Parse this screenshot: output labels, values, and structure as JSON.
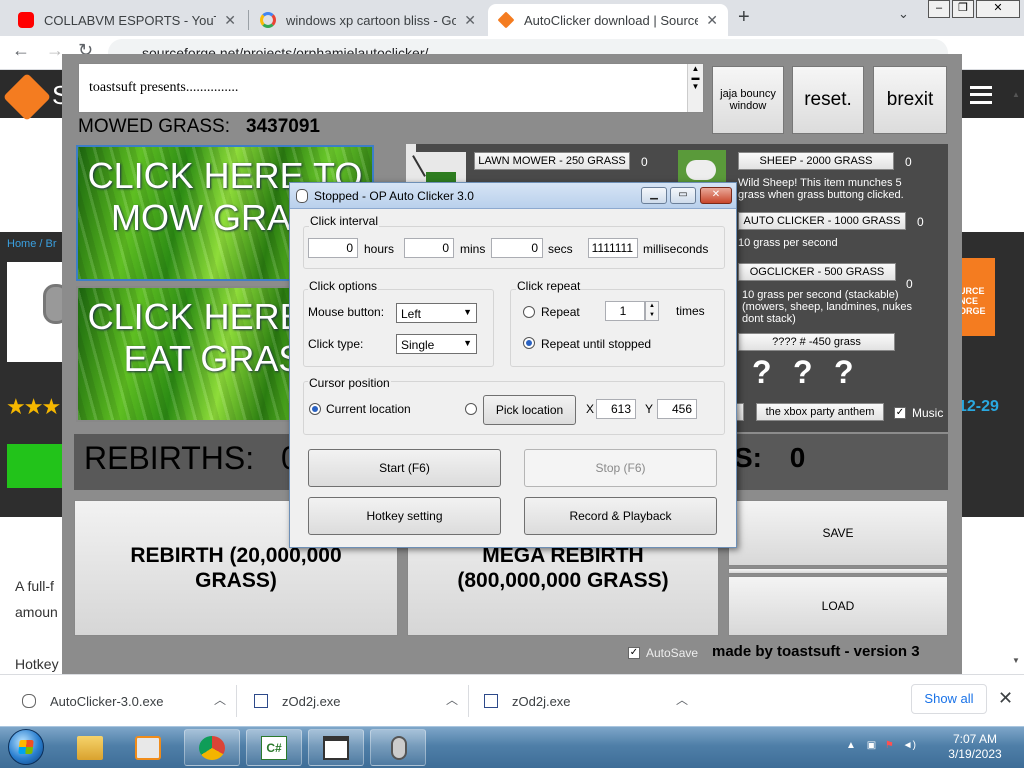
{
  "browser": {
    "tabs": [
      {
        "title": "COLLABVM ESPORTS - YouTube",
        "active": false
      },
      {
        "title": "windows xp cartoon bliss - Goog",
        "active": false
      },
      {
        "title": "AutoClicker download | SourceFo",
        "active": true
      }
    ],
    "url": "sourceforge.net/projects/orphamielautoclicker/"
  },
  "sourceforge": {
    "logo_letter": "S",
    "breadcrumb": "Home / Br",
    "date_fragment": "12-29",
    "badge_text": "URCE NCE ORGE",
    "text_line1": "A full-f",
    "text_line2": "amoun",
    "text_line3": "Hotkey"
  },
  "game": {
    "presents_text": "toastsuft presents...............",
    "buttons": {
      "bouncy": "jaja bouncy window",
      "reset": "reset.",
      "brexit": "brexit"
    },
    "mowed_label": "MOWED GRASS:",
    "mowed_value": "3437091",
    "click_mow": "CLICK HERE TO MOW GRASS",
    "click_eat": "CLICK HERE TO EAT GRASS",
    "shop": {
      "lawnmower_btn": "LAWN MOWER - 250 GRASS",
      "lawnmower_count": "0",
      "sheep_btn": "SHEEP - 2000 GRASS",
      "sheep_count": "0",
      "sheep_desc": "Wild Sheep! This item munches 5 grass when grass buttong clicked.",
      "autoclicker_btn": "AUTO CLICKER - 1000 GRASS",
      "autoclicker_count": "0",
      "autoclicker_desc": "10 grass per second",
      "ogclicker_btn": "OGCLICKER - 500 GRASS",
      "ogclicker_count": "0",
      "ogclicker_desc": "10 grass per second (stackable) (mowers, sheep, landmines, nukes dont stack)",
      "mystery_btn": "???? # -450 grass",
      "mystery_marks": [
        "?",
        "?",
        "?"
      ],
      "anthem_btn": "the xbox party anthem",
      "music_label": "Music",
      "music_checked": true
    },
    "rebirths_label": "REBIRTHS:",
    "rebirths_value": "0",
    "mega_fragment": "S:",
    "mega_value": "0",
    "rebirth_btn": "REBIRTH (20,000,000 GRASS)",
    "mega_rebirth_btn": "MEGA REBIRTH (800,000,000 GRASS)",
    "save_btn": "SAVE",
    "load_btn": "LOAD",
    "autosave_label": "AutoSave",
    "autosave_checked": true,
    "made_by": "made by toastsuft - version 3"
  },
  "clicker": {
    "title": "Stopped - OP Auto Clicker 3.0",
    "interval_label": "Click interval",
    "hours_value": "0",
    "hours_label": "hours",
    "mins_value": "0",
    "mins_label": "mins",
    "secs_value": "0",
    "secs_label": "secs",
    "ms_value": "1111111",
    "ms_label": "milliseconds",
    "options_label": "Click options",
    "mouse_button_label": "Mouse button:",
    "mouse_button_value": "Left",
    "click_type_label": "Click type:",
    "click_type_value": "Single",
    "repeat_group_label": "Click repeat",
    "repeat_label": "Repeat",
    "repeat_value": "1",
    "times_label": "times",
    "repeat_until_label": "Repeat until stopped",
    "repeat_mode": "until_stopped",
    "cursor_label": "Cursor position",
    "current_location_label": "Current location",
    "cursor_mode": "current",
    "pick_location_btn": "Pick location",
    "x_label": "X",
    "x_value": "613",
    "y_label": "Y",
    "y_value": "456",
    "start_btn": "Start (F6)",
    "stop_btn": "Stop (F6)",
    "hotkey_btn": "Hotkey setting",
    "record_btn": "Record & Playback"
  },
  "downloads": {
    "items": [
      {
        "name": "AutoClicker-3.0.exe"
      },
      {
        "name": "zOd2j.exe"
      },
      {
        "name": "zOd2j.exe"
      }
    ],
    "show_all": "Show all"
  },
  "taskbar": {
    "time": "7:07 AM",
    "date": "3/19/2023"
  }
}
